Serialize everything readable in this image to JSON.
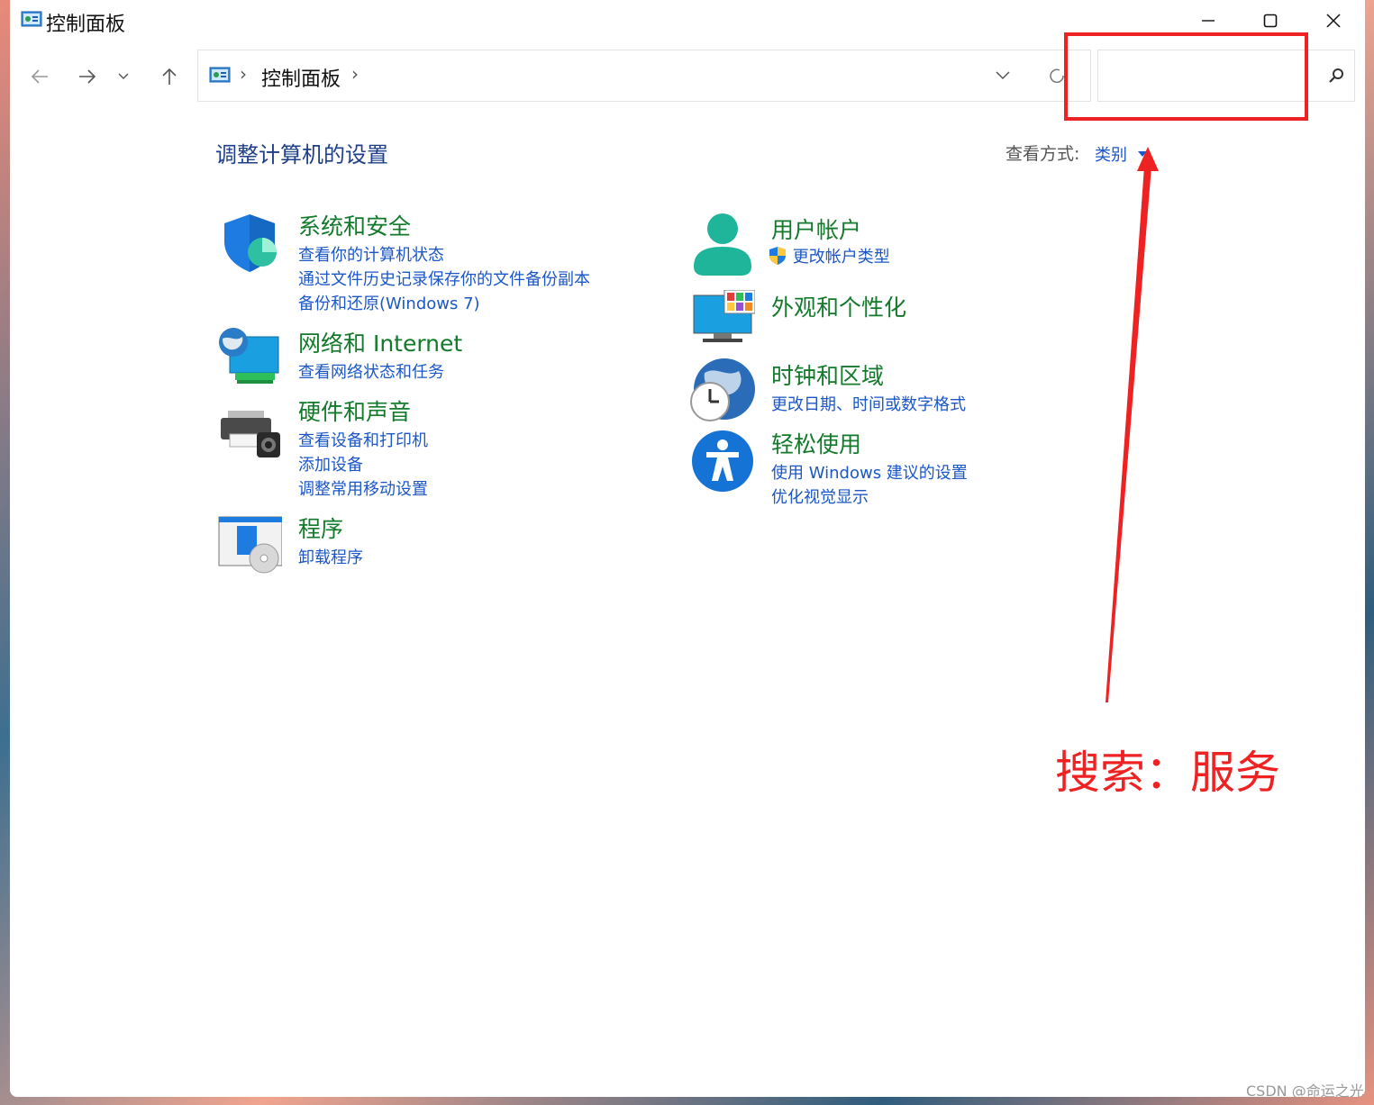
{
  "window": {
    "title": "控制面板"
  },
  "address": {
    "path": "控制面板",
    "separator": "›"
  },
  "search": {
    "value": "",
    "placeholder": ""
  },
  "main": {
    "heading": "调整计算机的设置",
    "view_by_label": "查看方式:",
    "view_by_value": "类别"
  },
  "categories": {
    "system": {
      "title": "系统和安全",
      "links": [
        "查看你的计算机状态",
        "通过文件历史记录保存你的文件备份副本",
        "备份和还原(Windows 7)"
      ]
    },
    "network": {
      "title": "网络和 Internet",
      "links": [
        "查看网络状态和任务"
      ]
    },
    "hardware": {
      "title": "硬件和声音",
      "links": [
        "查看设备和打印机",
        "添加设备",
        "调整常用移动设置"
      ]
    },
    "programs": {
      "title": "程序",
      "links": [
        "卸载程序"
      ]
    },
    "accounts": {
      "title": "用户帐户",
      "links": [
        "更改帐户类型"
      ]
    },
    "appearance": {
      "title": "外观和个性化",
      "links": []
    },
    "clock": {
      "title": "时钟和区域",
      "links": [
        "更改日期、时间或数字格式"
      ]
    },
    "ease": {
      "title": "轻松使用",
      "links": [
        "使用 Windows 建议的设置",
        "优化视觉显示"
      ]
    }
  },
  "annotation": {
    "text": "搜索：服务",
    "color": "#ee2222"
  },
  "watermark": "CSDN @命运之光",
  "colors": {
    "link": "#1b57c7",
    "category_title": "#127a2a",
    "heading": "#1e3f8a"
  }
}
